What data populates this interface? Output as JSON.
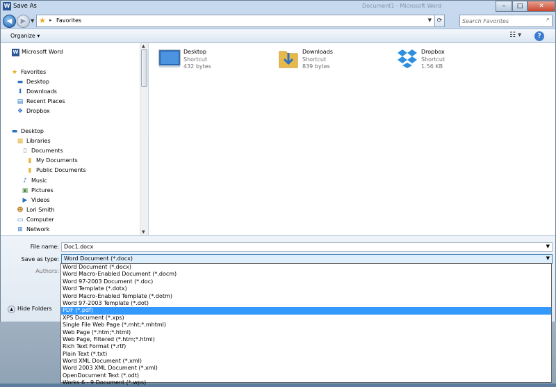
{
  "window": {
    "title": "Save As",
    "background_title": "Document1 - Microsoft Word",
    "app_icon": "W",
    "controls": {
      "minimize": "–",
      "maximize": "□",
      "close": "✕"
    }
  },
  "nav": {
    "breadcrumb": "Favorites",
    "search_placeholder": "Search Favorites"
  },
  "toolbar": {
    "organize": "Organize ▾"
  },
  "sidebar": {
    "items": [
      {
        "label": "Microsoft Word",
        "icon": "word-icon"
      },
      {
        "label": "Favorites",
        "icon": "star-icon"
      },
      {
        "label": "Desktop",
        "icon": "desktop-icon"
      },
      {
        "label": "Downloads",
        "icon": "downloads-icon"
      },
      {
        "label": "Recent Places",
        "icon": "recent-places-icon"
      },
      {
        "label": "Dropbox",
        "icon": "dropbox-icon"
      },
      {
        "label": "Desktop",
        "icon": "desktop-icon"
      },
      {
        "label": "Libraries",
        "icon": "libraries-icon"
      },
      {
        "label": "Documents",
        "icon": "documents-icon"
      },
      {
        "label": "My Documents",
        "icon": "folder-icon"
      },
      {
        "label": "Public Documents",
        "icon": "folder-icon"
      },
      {
        "label": "Music",
        "icon": "music-icon"
      },
      {
        "label": "Pictures",
        "icon": "pictures-icon"
      },
      {
        "label": "Videos",
        "icon": "videos-icon"
      },
      {
        "label": "Lori Smith",
        "icon": "user-icon"
      },
      {
        "label": "Computer",
        "icon": "computer-icon"
      },
      {
        "label": "Network",
        "icon": "network-icon"
      }
    ]
  },
  "files": [
    {
      "name": "Desktop",
      "kind": "Shortcut",
      "size": "432 bytes",
      "icon": "desktop-shortcut-icon"
    },
    {
      "name": "Downloads",
      "kind": "Shortcut",
      "size": "839 bytes",
      "icon": "downloads-shortcut-icon"
    },
    {
      "name": "Dropbox",
      "kind": "Shortcut",
      "size": "1.56 KB",
      "icon": "dropbox-shortcut-icon"
    }
  ],
  "form": {
    "file_name_label": "File name:",
    "file_name_value": "Doc1.docx",
    "save_type_label": "Save as type:",
    "save_type_value": "Word Document (*.docx)",
    "authors_label": "Authors:",
    "hide_folders": "Hide Folders"
  },
  "type_options": [
    "Word Document (*.docx)",
    "Word Macro-Enabled Document (*.docm)",
    "Word 97-2003 Document (*.doc)",
    "Word Template (*.dotx)",
    "Word Macro-Enabled Template (*.dotm)",
    "Word 97-2003 Template (*.dot)",
    "PDF (*.pdf)",
    "XPS Document (*.xps)",
    "Single File Web Page (*.mht;*.mhtml)",
    "Web Page (*.htm;*.html)",
    "Web Page, Filtered (*.htm;*.html)",
    "Rich Text Format (*.rtf)",
    "Plain Text (*.txt)",
    "Word XML Document (*.xml)",
    "Word 2003 XML Document (*.xml)",
    "OpenDocument Text (*.odt)",
    "Works 6 - 9 Document (*.wps)"
  ],
  "highlighted_option": "PDF (*.pdf)"
}
